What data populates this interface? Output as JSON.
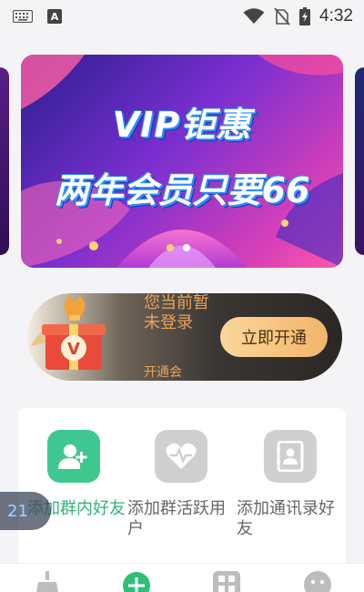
{
  "status_bar": {
    "time": "4:32",
    "icons": [
      "keyboard-icon",
      "a-icon",
      "wifi-icon",
      "no-sim-icon",
      "battery-charging-icon"
    ],
    "a_label": "A"
  },
  "banner": {
    "title": "VIP钜惠",
    "subtitle": "两年会员只要66",
    "page_count": 2,
    "active_page": 2
  },
  "vip_card": {
    "message": "您当前暂未登录",
    "sub_text": "开通会",
    "button_label": "立即开通",
    "gift_letter": "V"
  },
  "functions": [
    {
      "label": "添加群内好友",
      "icon": "add-user-icon",
      "active": true
    },
    {
      "label": "添加群活跃用户",
      "icon": "heartbeat-icon",
      "active": false
    },
    {
      "label": "添加通讯录好友",
      "icon": "contacts-icon",
      "active": false
    }
  ],
  "float_badge": {
    "text": "21"
  },
  "bottom_nav": {
    "items": [
      "broom-icon",
      "plus-circle-icon",
      "grid-icon",
      "face-icon"
    ]
  },
  "colors": {
    "accent_green": "#3ec88f",
    "vip_gold": "#e8a25a"
  }
}
